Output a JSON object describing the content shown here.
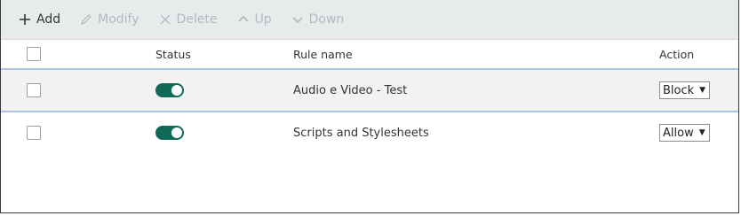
{
  "toolbar": {
    "add_label": "Add",
    "modify_label": "Modify",
    "delete_label": "Delete",
    "up_label": "Up",
    "down_label": "Down"
  },
  "table": {
    "columns": {
      "status": "Status",
      "rule_name": "Rule name",
      "action": "Action"
    },
    "rows": [
      {
        "status": "on",
        "name": "Audio e Video - Test",
        "action": "Block"
      },
      {
        "status": "on",
        "name": "Scripts and Stylesheets",
        "action": "Allow"
      }
    ]
  },
  "colors": {
    "toggle_on": "#0f6b57",
    "toolbar_bg": "#e7ebec",
    "selection_border": "#a9c4ee"
  }
}
